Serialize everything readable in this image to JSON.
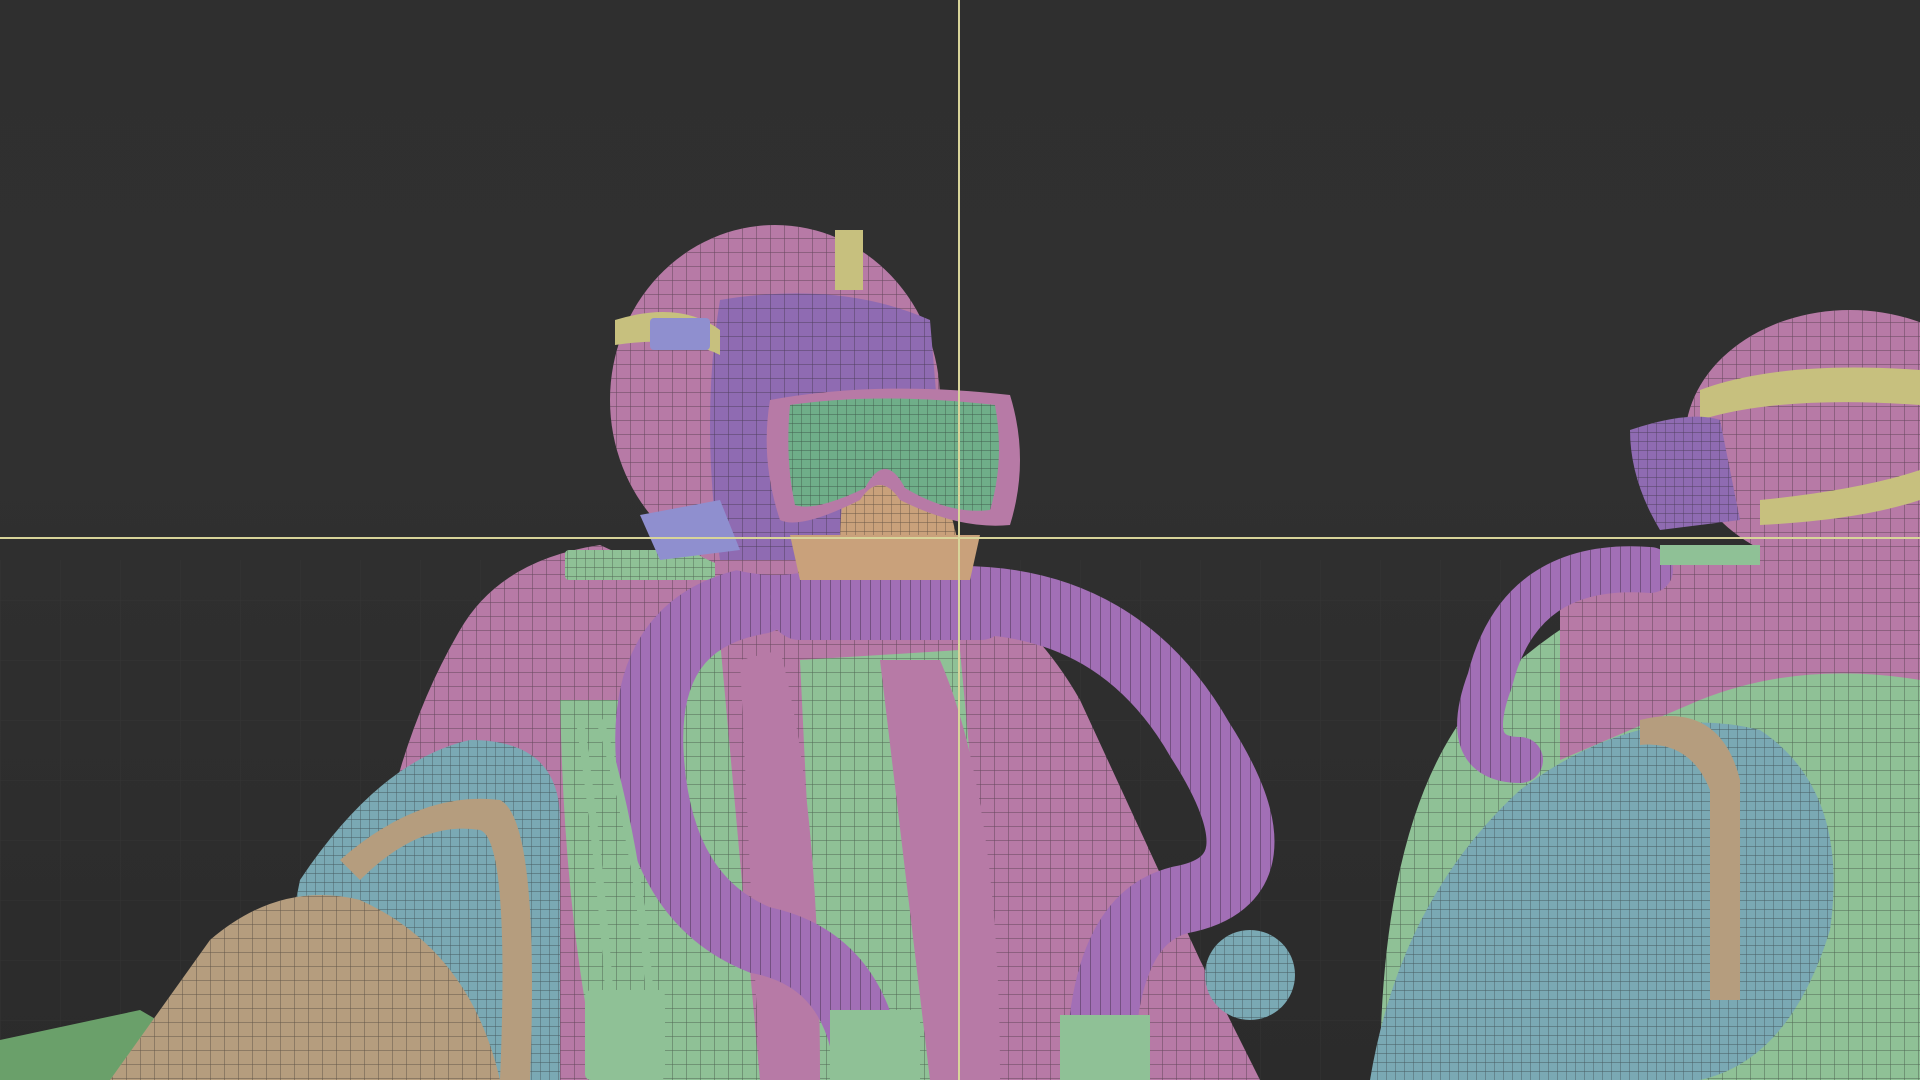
{
  "viewport": {
    "mode": "3d-viewport",
    "display": "wireframe-on-shaded",
    "background_color": "#2f2f2f",
    "crosshair_color": "#d8d49a",
    "objects": [
      "diver-character-left",
      "diver-character-right",
      "ground-grid"
    ]
  },
  "colors": {
    "helmet_pink": "#b77aa6",
    "strap_purple": "#8f6bb2",
    "goggle_green": "#6fae89",
    "skin_tan": "#c9a17b",
    "suit_blue": "#7aa9b4",
    "harness_green": "#8fc196",
    "pad_khaki": "#b59d7e",
    "hose_purple": "#a26fb6"
  }
}
